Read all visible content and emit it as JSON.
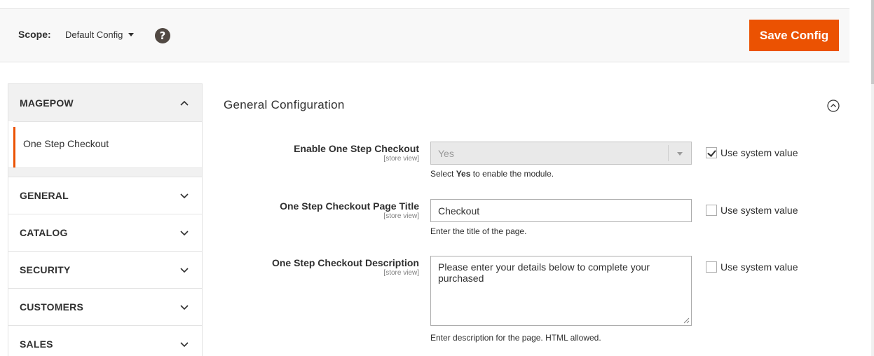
{
  "scope": {
    "label": "Scope:",
    "value": "Default Config",
    "help_icon": "question-circle-icon"
  },
  "toolbar": {
    "save_label": "Save Config",
    "accent": "#eb5202"
  },
  "sidebar": {
    "sections": [
      {
        "title": "MAGEPOW",
        "expanded": true,
        "items": [
          {
            "label": "One Step Checkout",
            "active": true
          }
        ]
      },
      {
        "title": "GENERAL",
        "expanded": false
      },
      {
        "title": "CATALOG",
        "expanded": false
      },
      {
        "title": "SECURITY",
        "expanded": false
      },
      {
        "title": "CUSTOMERS",
        "expanded": false
      },
      {
        "title": "SALES",
        "expanded": false
      }
    ]
  },
  "main": {
    "section_title": "General Configuration",
    "fields": [
      {
        "label": "Enable One Step Checkout",
        "scope": "[store view]",
        "value": "Yes",
        "hint_pre": "Select ",
        "hint_bold": "Yes",
        "hint_post": " to enable the module.",
        "use_system_label": "Use system value",
        "use_system_checked": true
      },
      {
        "label": "One Step Checkout Page Title",
        "scope": "[store view]",
        "value": "Checkout",
        "hint": "Enter the title of the page.",
        "use_system_label": "Use system value",
        "use_system_checked": false
      },
      {
        "label": "One Step Checkout Description",
        "scope": "[store view]",
        "value": "Please enter your details below to complete your purchased",
        "hint": "Enter description for the page. HTML allowed.",
        "use_system_label": "Use system value",
        "use_system_checked": false
      }
    ]
  }
}
